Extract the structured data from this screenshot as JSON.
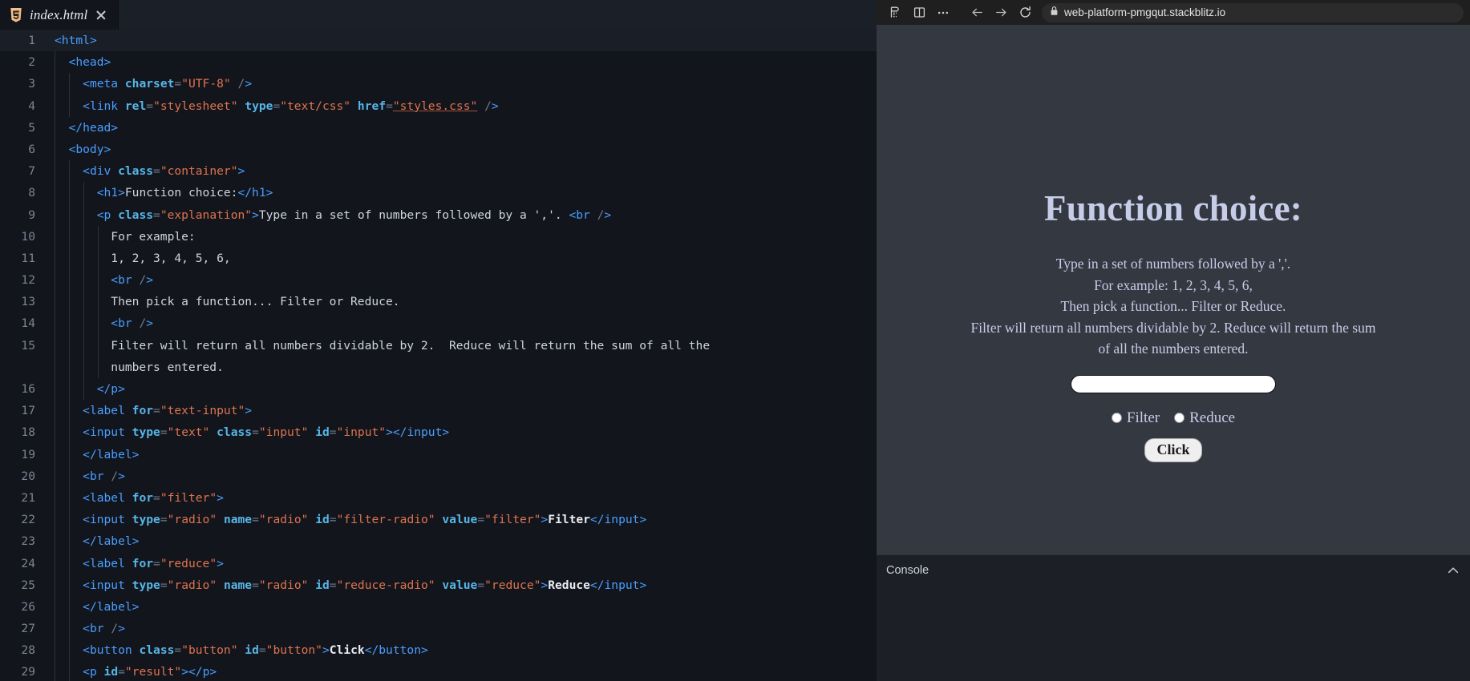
{
  "editor": {
    "tab": {
      "filename": "index.html",
      "icon": "html5-icon",
      "close_icon": "close-icon"
    },
    "lines": [
      {
        "n": "1",
        "indent": 0
      },
      {
        "n": "2",
        "indent": 1
      },
      {
        "n": "3",
        "indent": 2
      },
      {
        "n": "4",
        "indent": 2
      },
      {
        "n": "5",
        "indent": 1
      },
      {
        "n": "6",
        "indent": 1
      },
      {
        "n": "7",
        "indent": 2
      },
      {
        "n": "8",
        "indent": 3
      },
      {
        "n": "9",
        "indent": 3
      },
      {
        "n": "10",
        "indent": 4
      },
      {
        "n": "11",
        "indent": 4
      },
      {
        "n": "12",
        "indent": 4
      },
      {
        "n": "13",
        "indent": 4
      },
      {
        "n": "14",
        "indent": 4
      },
      {
        "n": "15",
        "indent": 4
      },
      {
        "n": "16",
        "indent": 3
      },
      {
        "n": "17",
        "indent": 2
      },
      {
        "n": "18",
        "indent": 2
      },
      {
        "n": "19",
        "indent": 2
      },
      {
        "n": "20",
        "indent": 2
      },
      {
        "n": "21",
        "indent": 2
      },
      {
        "n": "22",
        "indent": 2
      },
      {
        "n": "23",
        "indent": 2
      },
      {
        "n": "24",
        "indent": 2
      },
      {
        "n": "25",
        "indent": 2
      },
      {
        "n": "26",
        "indent": 2
      },
      {
        "n": "27",
        "indent": 2
      },
      {
        "n": "28",
        "indent": 2
      },
      {
        "n": "29",
        "indent": 2
      }
    ],
    "code_text": {
      "l1": "<html>",
      "l2": "  <head>",
      "l3": "    <meta charset=\"UTF-8\" />",
      "l4": "    <link rel=\"stylesheet\" type=\"text/css\" href=\"styles.css\" />",
      "l5": "  </head>",
      "l6": "  <body>",
      "l7": "    <div class=\"container\">",
      "l8": "      <h1>Function choice:</h1>",
      "l9": "      <p class=\"explanation\">Type in a set of numbers followed by a ','. <br />",
      "l10": "        For example:",
      "l11": "        1, 2, 3, 4, 5, 6,",
      "l12": "        <br />",
      "l13": "        Then pick a function... Filter or Reduce.",
      "l14": "        <br />",
      "l15": "        Filter will return all numbers dividable by 2.  Reduce will return the sum of all the",
      "l15b": "        numbers entered.",
      "l16": "      </p>",
      "l17": "    <label for=\"text-input\">",
      "l18": "    <input type=\"text\" class=\"input\" id=\"input\"></input>",
      "l19": "    </label>",
      "l20": "    <br />",
      "l21": "    <label for=\"filter\">",
      "l22": "    <input type=\"radio\" name=\"radio\" id=\"filter-radio\" value=\"filter\">Filter</input>",
      "l23": "    </label>",
      "l24": "    <label for=\"reduce\">",
      "l25": "    <input type=\"radio\" name=\"radio\" id=\"reduce-radio\" value=\"reduce\">Reduce</input>",
      "l26": "    </label>",
      "l27": "    <br />",
      "l28": "    <button class=\"button\" id=\"button\">Click</button>",
      "l29": "    <p id=\"result\"></p>"
    }
  },
  "browser": {
    "icons": [
      "panel-left-icon",
      "split-view-icon",
      "more-options-icon",
      "back-arrow-icon",
      "forward-arrow-icon",
      "reload-icon",
      "lock-icon"
    ],
    "url": "web-platform-pmgqut.stackblitz.io"
  },
  "preview": {
    "heading": "Function choice:",
    "explanation_line1": "Type in a set of numbers followed by a ','.",
    "explanation_line2": "For example: 1, 2, 3, 4, 5, 6,",
    "explanation_line3": "Then pick a function... Filter or Reduce.",
    "explanation_line4": "Filter will return all numbers dividable by 2. Reduce will return the sum",
    "explanation_line5": "of all the numbers entered.",
    "input_value": "",
    "input_placeholder": "",
    "radio_filter_label": "Filter",
    "radio_reduce_label": "Reduce",
    "button_label": "Click",
    "result_text": ""
  },
  "console": {
    "label": "Console",
    "expand_icon": "chevron-up-icon"
  },
  "colors": {
    "editor_bg": "#12151c",
    "tabbar_bg": "#1b1f28",
    "preview_bg": "#343841",
    "preview_text": "#c6cde8",
    "tag_blue": "#4a9eff",
    "string_orange": "#e0734e",
    "browser_bg": "#1f1f1f"
  }
}
